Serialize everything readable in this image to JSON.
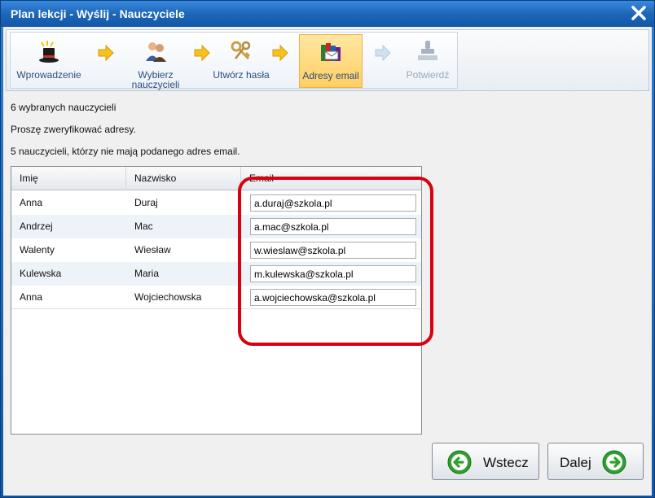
{
  "window": {
    "title": "Plan lekcji - Wyślij - Nauczyciele"
  },
  "wizard": {
    "steps": [
      {
        "label": "Wprowadzenie",
        "icon": "magic-hat-icon"
      },
      {
        "label": "Wybierz nauczycieli",
        "icon": "teachers-icon"
      },
      {
        "label": "Utwórz hasła",
        "icon": "keys-icon"
      },
      {
        "label": "Adresy email",
        "icon": "email-books-icon",
        "active": true
      },
      {
        "label": "Potwierdź",
        "icon": "stamp-icon",
        "disabled": true
      }
    ]
  },
  "info": {
    "selected": "6 wybranych nauczycieli",
    "verify": "Proszę zweryfikować adresy.",
    "missing": "5 nauczycieli, którzy nie mają podanego adres email."
  },
  "grid": {
    "headers": {
      "first_name": "Imię",
      "last_name": "Nazwisko",
      "email": "Email"
    },
    "rows": [
      {
        "first_name": "Anna",
        "last_name": "Duraj",
        "email": "a.duraj@szkola.pl"
      },
      {
        "first_name": "Andrzej",
        "last_name": "Mac",
        "email": "a.mac@szkola.pl"
      },
      {
        "first_name": "Walenty",
        "last_name": "Wiesław",
        "email": "w.wieslaw@szkola.pl"
      },
      {
        "first_name": "Kulewska",
        "last_name": "Maria",
        "email": "m.kulewska@szkola.pl"
      },
      {
        "first_name": "Anna",
        "last_name": "Wojciechowska",
        "email": "a.wojciechowska@szkola.pl"
      }
    ]
  },
  "buttons": {
    "back": "Wstecz",
    "next": "Dalej"
  },
  "colors": {
    "highlight": "#d9000f",
    "accent_green": "#2fa12f",
    "active_step": "#ffd36b"
  }
}
